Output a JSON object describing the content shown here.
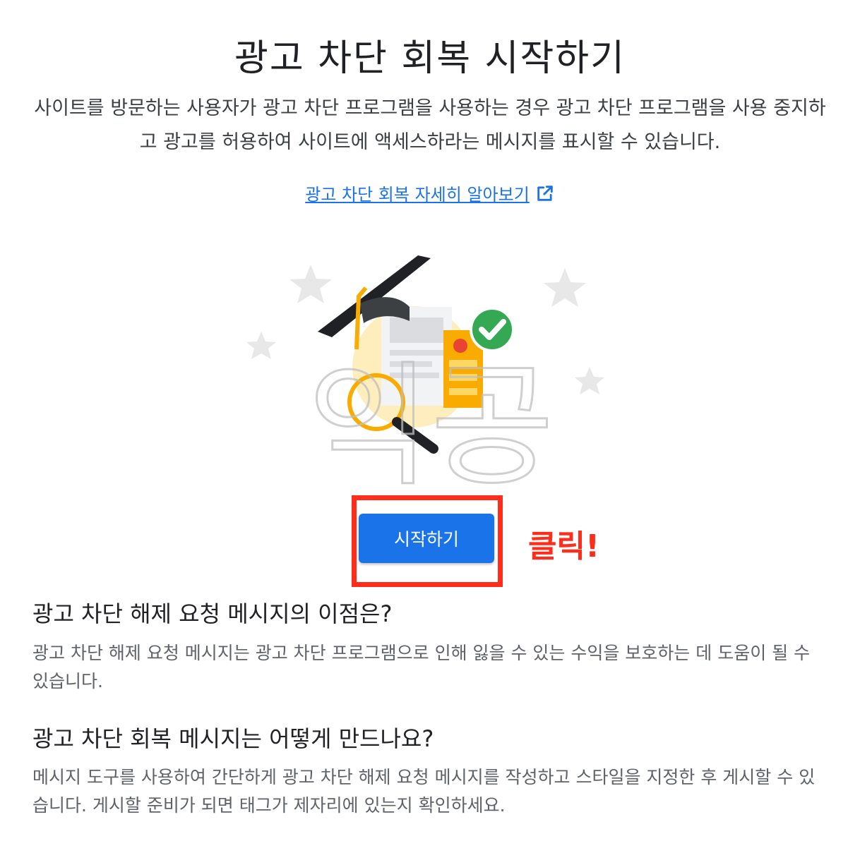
{
  "header": {
    "title": "광고 차단 회복 시작하기",
    "description": "사이트를 방문하는 사용자가 광고 차단 프로그램을 사용하는 경우 광고 차단 프로그램을 사용 중지하고 광고를 허용하여 사이트에 액세스하라는 메시지를 표시할 수 있습니다.",
    "learn_more_link": "광고 차단 회복 자세히 알아보기"
  },
  "illustration": {
    "watermark_text": "익공"
  },
  "cta": {
    "start_button_label": "시작하기",
    "annotation_label": "클릭!"
  },
  "sections": [
    {
      "heading": "광고 차단 해제 요청 메시지의 이점은?",
      "body": "광고 차단 해제 요청 메시지는 광고 차단 프로그램으로 인해 잃을 수 있는 수익을 보호하는 데 도움이 될 수 있습니다."
    },
    {
      "heading": "광고 차단 회복 메시지는 어떻게 만드나요?",
      "body": "메시지 도구를 사용하여 간단하게 광고 차단 해제 요청 메시지를 작성하고 스타일을 지정한 후 게시할 수 있습니다. 게시할 준비가 되면 태그가 제자리에 있는지 확인하세요."
    }
  ],
  "colors": {
    "accent": "#1a73e8",
    "annotation": "#ff2d1a",
    "check_green": "#34a853",
    "circle_yellow": "#fde293",
    "cap": "#202124",
    "tassel": "#f9ab00"
  }
}
